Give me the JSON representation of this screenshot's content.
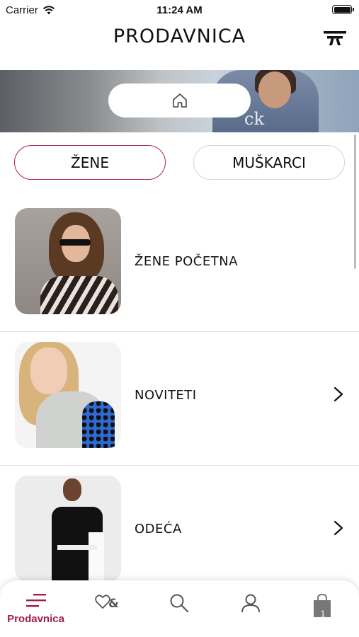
{
  "status_bar": {
    "carrier": "Carrier",
    "time": "11:24 AM"
  },
  "header": {
    "title": "PRODAVNICA",
    "logo_icon": "brand-logo-icon"
  },
  "banner": {
    "home_icon": "home-icon",
    "overlay_text": "ck"
  },
  "tabs": [
    {
      "label": "ŽENE",
      "active": true
    },
    {
      "label": "MUŠKARCI",
      "active": false
    }
  ],
  "categories": [
    {
      "label": "ŽENE POČETNA",
      "has_chevron": false
    },
    {
      "label": "NOVITETI",
      "has_chevron": true
    },
    {
      "label": "ODEĆA",
      "has_chevron": true
    }
  ],
  "tab_bar": {
    "items": [
      {
        "icon": "menu-icon",
        "label": "Prodavnica",
        "active": true
      },
      {
        "icon": "wishlist-icon",
        "label": ""
      },
      {
        "icon": "search-icon",
        "label": ""
      },
      {
        "icon": "profile-icon",
        "label": ""
      },
      {
        "icon": "cart-icon",
        "label": "",
        "badge": "1"
      }
    ]
  },
  "colors": {
    "accent": "#a21c50",
    "border": "#d5d5d5",
    "divider": "#e2e2e2"
  }
}
